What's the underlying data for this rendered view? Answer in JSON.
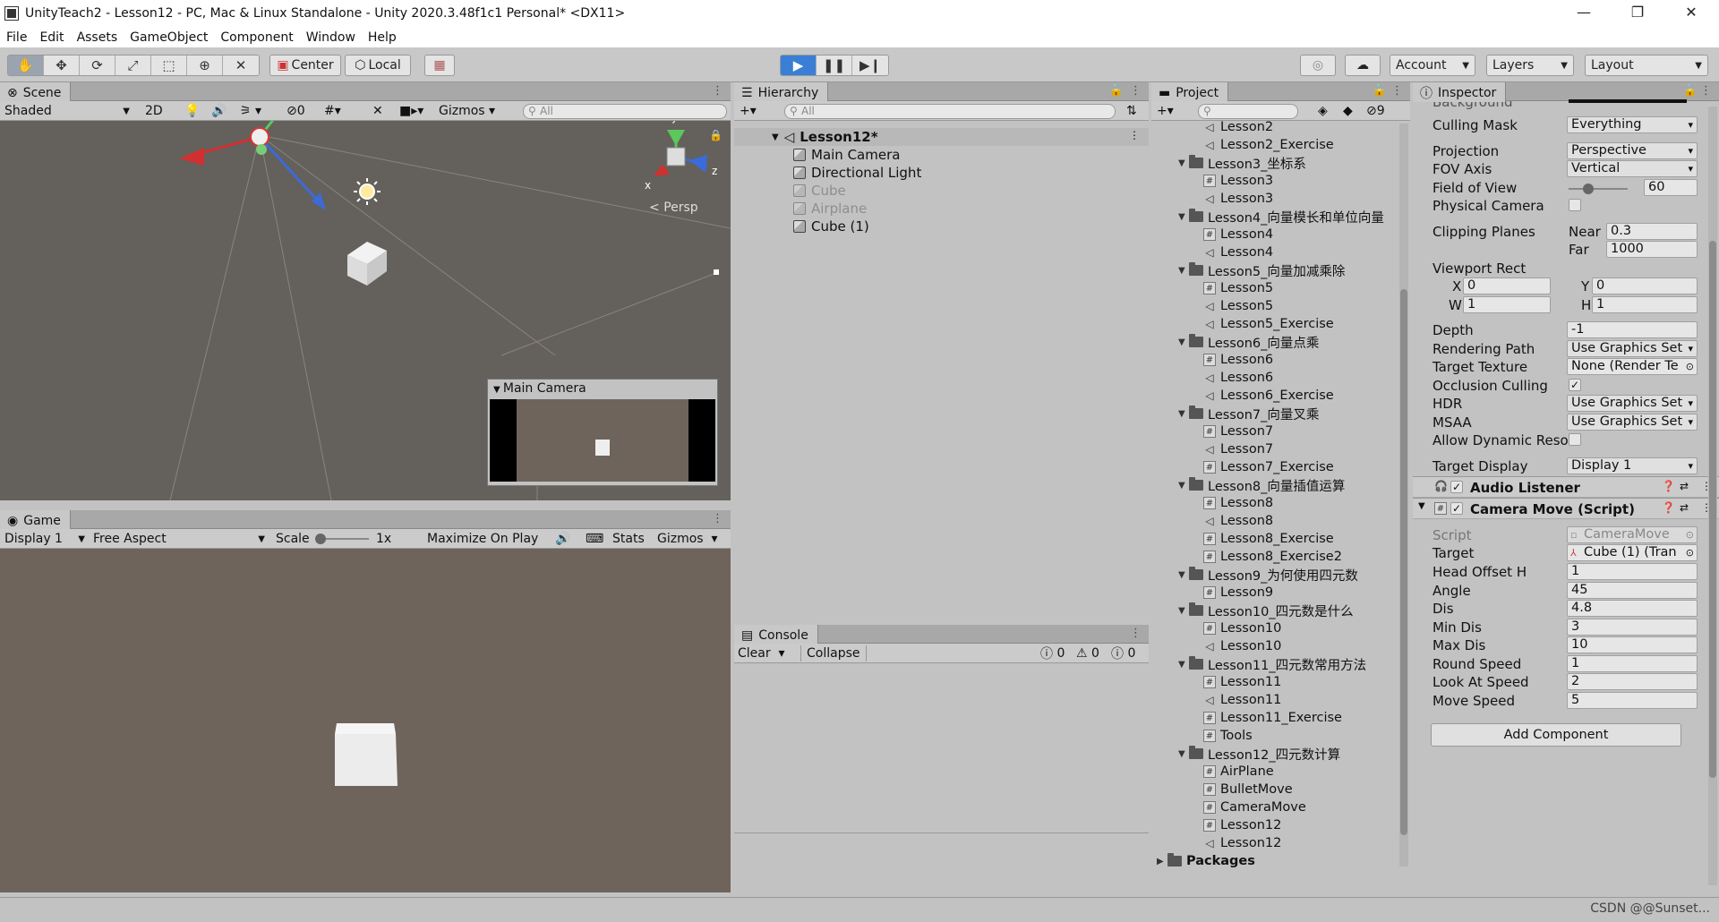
{
  "window": {
    "title": "UnityTeach2 - Lesson12 - PC, Mac & Linux Standalone - Unity 2020.3.48f1c1 Personal* <DX11>",
    "minimize": "—",
    "restore": "❐",
    "close": "✕"
  },
  "menu": [
    "File",
    "Edit",
    "Assets",
    "GameObject",
    "Component",
    "Window",
    "Help"
  ],
  "toolbar": {
    "pivot": "Center",
    "space": "Local",
    "account": "Account",
    "layers": "Layers",
    "layout": "Layout"
  },
  "scene": {
    "tab": "Scene",
    "shading": "Shaded",
    "mode_2d": "2D",
    "hidden_count": "0",
    "gizmos": "Gizmos",
    "search_placeholder": "All",
    "persp": "Persp",
    "axis_x": "x",
    "axis_y": "y",
    "axis_z": "z",
    "camera_preview_title": "Main Camera"
  },
  "game": {
    "tab": "Game",
    "display": "Display 1",
    "aspect": "Free Aspect",
    "scale_label": "Scale",
    "scale_value": "1x",
    "maximize": "Maximize On Play",
    "stats": "Stats",
    "gizmos": "Gizmos"
  },
  "hierarchy": {
    "tab": "Hierarchy",
    "search_placeholder": "All",
    "scene_name": "Lesson12*",
    "items": [
      {
        "label": "Main Camera",
        "active": true
      },
      {
        "label": "Directional Light",
        "active": true
      },
      {
        "label": "Cube",
        "active": false
      },
      {
        "label": "Airplane",
        "active": false
      },
      {
        "label": "Cube (1)",
        "active": true
      }
    ]
  },
  "console": {
    "tab": "Console",
    "clear": "Clear",
    "collapse": "Collapse",
    "log_count": "0",
    "warn_count": "0",
    "error_count": "0"
  },
  "project": {
    "tab": "Project",
    "hidden_count": "9",
    "rows": [
      {
        "kind": "scene",
        "indent": 2,
        "label": "Lesson2"
      },
      {
        "kind": "scene",
        "indent": 2,
        "label": "Lesson2_Exercise"
      },
      {
        "kind": "folder",
        "indent": 1,
        "label": "Lesson3_坐标系"
      },
      {
        "kind": "script",
        "indent": 2,
        "label": "Lesson3"
      },
      {
        "kind": "scene",
        "indent": 2,
        "label": "Lesson3"
      },
      {
        "kind": "folder",
        "indent": 1,
        "label": "Lesson4_向量模长和单位向量"
      },
      {
        "kind": "script",
        "indent": 2,
        "label": "Lesson4"
      },
      {
        "kind": "scene",
        "indent": 2,
        "label": "Lesson4"
      },
      {
        "kind": "folder",
        "indent": 1,
        "label": "Lesson5_向量加减乘除"
      },
      {
        "kind": "script",
        "indent": 2,
        "label": "Lesson5"
      },
      {
        "kind": "scene",
        "indent": 2,
        "label": "Lesson5"
      },
      {
        "kind": "scene",
        "indent": 2,
        "label": "Lesson5_Exercise"
      },
      {
        "kind": "folder",
        "indent": 1,
        "label": "Lesson6_向量点乘"
      },
      {
        "kind": "script",
        "indent": 2,
        "label": "Lesson6"
      },
      {
        "kind": "scene",
        "indent": 2,
        "label": "Lesson6"
      },
      {
        "kind": "scene",
        "indent": 2,
        "label": "Lesson6_Exercise"
      },
      {
        "kind": "folder",
        "indent": 1,
        "label": "Lesson7_向量叉乘"
      },
      {
        "kind": "script",
        "indent": 2,
        "label": "Lesson7"
      },
      {
        "kind": "scene",
        "indent": 2,
        "label": "Lesson7"
      },
      {
        "kind": "script",
        "indent": 2,
        "label": "Lesson7_Exercise"
      },
      {
        "kind": "folder",
        "indent": 1,
        "label": "Lesson8_向量插值运算"
      },
      {
        "kind": "script",
        "indent": 2,
        "label": "Lesson8"
      },
      {
        "kind": "scene",
        "indent": 2,
        "label": "Lesson8"
      },
      {
        "kind": "script",
        "indent": 2,
        "label": "Lesson8_Exercise"
      },
      {
        "kind": "script",
        "indent": 2,
        "label": "Lesson8_Exercise2"
      },
      {
        "kind": "folder",
        "indent": 1,
        "label": "Lesson9_为何使用四元数"
      },
      {
        "kind": "script",
        "indent": 2,
        "label": "Lesson9"
      },
      {
        "kind": "folder",
        "indent": 1,
        "label": "Lesson10_四元数是什么"
      },
      {
        "kind": "script",
        "indent": 2,
        "label": "Lesson10"
      },
      {
        "kind": "scene",
        "indent": 2,
        "label": "Lesson10"
      },
      {
        "kind": "folder",
        "indent": 1,
        "label": "Lesson11_四元数常用方法"
      },
      {
        "kind": "script",
        "indent": 2,
        "label": "Lesson11"
      },
      {
        "kind": "scene",
        "indent": 2,
        "label": "Lesson11"
      },
      {
        "kind": "script",
        "indent": 2,
        "label": "Lesson11_Exercise"
      },
      {
        "kind": "script",
        "indent": 2,
        "label": "Tools"
      },
      {
        "kind": "folder",
        "indent": 1,
        "label": "Lesson12_四元数计算"
      },
      {
        "kind": "script",
        "indent": 2,
        "label": "AirPlane"
      },
      {
        "kind": "script",
        "indent": 2,
        "label": "BulletMove"
      },
      {
        "kind": "script",
        "indent": 2,
        "label": "CameraMove"
      },
      {
        "kind": "script",
        "indent": 2,
        "label": "Lesson12"
      },
      {
        "kind": "scene",
        "indent": 2,
        "label": "Lesson12"
      },
      {
        "kind": "folder",
        "indent": 0,
        "label": "Packages",
        "bold": true
      }
    ]
  },
  "inspector": {
    "tab": "Inspector",
    "cut_label": "Background",
    "camera": {
      "culling_mask_label": "Culling Mask",
      "culling_mask": "Everything",
      "projection_label": "Projection",
      "projection": "Perspective",
      "fov_axis_label": "FOV Axis",
      "fov_axis": "Vertical",
      "fov_label": "Field of View",
      "fov": "60",
      "fov_slider": 0.33,
      "physical_label": "Physical Camera",
      "clipping_label": "Clipping Planes",
      "near_label": "Near",
      "near": "0.3",
      "far_label": "Far",
      "far": "1000",
      "viewport_label": "Viewport Rect",
      "x_label": "X",
      "x": "0",
      "y_label": "Y",
      "y": "0",
      "w_label": "W",
      "w": "1",
      "h_label": "H",
      "h": "1",
      "depth_label": "Depth",
      "depth": "-1",
      "rendering_path_label": "Rendering Path",
      "rendering_path": "Use Graphics Set",
      "target_texture_label": "Target Texture",
      "target_texture": "None (Render Te",
      "occlusion_label": "Occlusion Culling",
      "hdr_label": "HDR",
      "hdr": "Use Graphics Set",
      "msaa_label": "MSAA",
      "msaa": "Use Graphics Set",
      "dynamic_res_label": "Allow Dynamic Reso",
      "target_display_label": "Target Display",
      "target_display": "Display 1"
    },
    "audio_listener": "Audio Listener",
    "camera_move": {
      "title": "Camera Move (Script)",
      "script_label": "Script",
      "script": "CameraMove",
      "target_label": "Target",
      "target": "Cube (1) (Tran",
      "fields": [
        {
          "label": "Head Offset H",
          "value": "1"
        },
        {
          "label": "Angle",
          "value": "45"
        },
        {
          "label": "Dis",
          "value": "4.8"
        },
        {
          "label": "Min Dis",
          "value": "3"
        },
        {
          "label": "Max Dis",
          "value": "10"
        },
        {
          "label": "Round Speed",
          "value": "1"
        },
        {
          "label": "Look At Speed",
          "value": "2"
        },
        {
          "label": "Move Speed",
          "value": "5"
        }
      ]
    },
    "add_component": "Add Component"
  },
  "watermark": "CSDN @@Sunset..."
}
